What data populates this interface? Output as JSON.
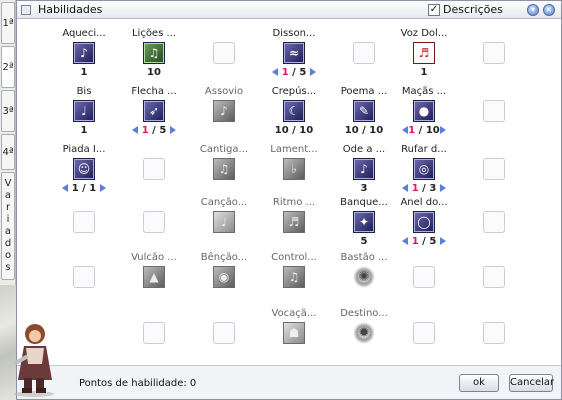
{
  "window": {
    "title": "Habilidades",
    "descriptions_label": "Descrições",
    "descriptions_checked": true
  },
  "tabs": [
    {
      "label": "1ª"
    },
    {
      "label": "2ª"
    },
    {
      "label": "3ª"
    },
    {
      "label": "4ª"
    },
    {
      "label": "Variados"
    }
  ],
  "skills": [
    {
      "name": "Aqueci...",
      "level": "1",
      "icon": "note-icon"
    },
    {
      "name": "Lições ...",
      "level": "10",
      "icon": "lesson-icon"
    },
    {
      "name": "Disson...",
      "level_cur": "1",
      "level_sep": " / ",
      "level_max": "5",
      "icon": "dissonance-icon"
    },
    {
      "name": "Voz Dol...",
      "level": "1",
      "icon": "music-note-icon"
    },
    {
      "name": "Bis",
      "level": "1",
      "icon": "encore-icon"
    },
    {
      "name": "Flecha ...",
      "level_cur": "1",
      "level_sep": " / ",
      "level_max": "5",
      "icon": "arrow-icon"
    },
    {
      "name": "Assovio",
      "icon": "whistle-icon"
    },
    {
      "name": "Crepús...",
      "level": "10 / 10",
      "icon": "twilight-icon"
    },
    {
      "name": "Poema ...",
      "level": "10 / 10",
      "icon": "poem-icon"
    },
    {
      "name": "Maçãs ...",
      "level_cur": "1",
      "level_sep": " / ",
      "level_max": "10",
      "icon": "apple-icon"
    },
    {
      "name": "Piada I...",
      "level": "1 / 1",
      "icon": "joke-icon"
    },
    {
      "name": "Cantiga...",
      "icon": "song-icon"
    },
    {
      "name": "Lament...",
      "icon": "lament-icon"
    },
    {
      "name": "Ode a ...",
      "level": "3",
      "icon": "ode-icon"
    },
    {
      "name": "Rufar d...",
      "level_cur": "1",
      "level_sep": " / ",
      "level_max": "3",
      "icon": "drum-icon"
    },
    {
      "name": "Canção...",
      "icon": "canticle-icon"
    },
    {
      "name": "Ritmo ...",
      "icon": "rhythm-icon"
    },
    {
      "name": "Banque...",
      "level": "5",
      "icon": "banquet-icon"
    },
    {
      "name": "Anel do...",
      "level_cur": "1",
      "level_sep": " / ",
      "level_max": "5",
      "icon": "ring-icon"
    },
    {
      "name": "Vulcão ...",
      "icon": "volcano-icon"
    },
    {
      "name": "Bênção...",
      "icon": "blessing-icon"
    },
    {
      "name": "Control...",
      "icon": "control-icon"
    },
    {
      "name": "Bastão ...",
      "icon": "staff-icon"
    },
    {
      "name": "Vocaçã...",
      "icon": "vocation-icon"
    },
    {
      "name": "Destino...",
      "icon": "destiny-icon"
    }
  ],
  "footer": {
    "points_label": "Pontos de habilidade: 0",
    "ok_label": "ok",
    "cancel_label": "Cancelar"
  }
}
